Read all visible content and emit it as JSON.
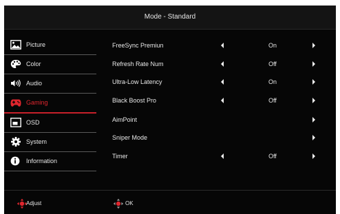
{
  "header": {
    "title": "Mode - Standard"
  },
  "sidebar": {
    "items": [
      {
        "label": "Picture",
        "icon": "picture-icon"
      },
      {
        "label": "Color",
        "icon": "palette-icon"
      },
      {
        "label": "Audio",
        "icon": "speaker-icon"
      },
      {
        "label": "Gaming",
        "icon": "gamepad-icon",
        "active": true
      },
      {
        "label": "OSD",
        "icon": "osd-icon"
      },
      {
        "label": "System",
        "icon": "gear-icon"
      },
      {
        "label": "Information",
        "icon": "info-icon"
      }
    ]
  },
  "settings": [
    {
      "label": "FreeSync Premiun",
      "value": "On"
    },
    {
      "label": "Refresh Rate Num",
      "value": "Off"
    },
    {
      "label": "Ultra-Low Latency",
      "value": "On"
    },
    {
      "label": "Black Boost Pro",
      "value": "Off"
    },
    {
      "label": "AimPoint",
      "value": ""
    },
    {
      "label": "Sniper Mode",
      "value": ""
    },
    {
      "label": "Timer",
      "value": "Off"
    }
  ],
  "footer": {
    "adjust_label": "Adjust",
    "ok_label": "OK"
  },
  "colors": {
    "accent": "#e0262e",
    "background": "#060606",
    "text": "#e8e8e8",
    "divider": "#5a5a5a"
  }
}
